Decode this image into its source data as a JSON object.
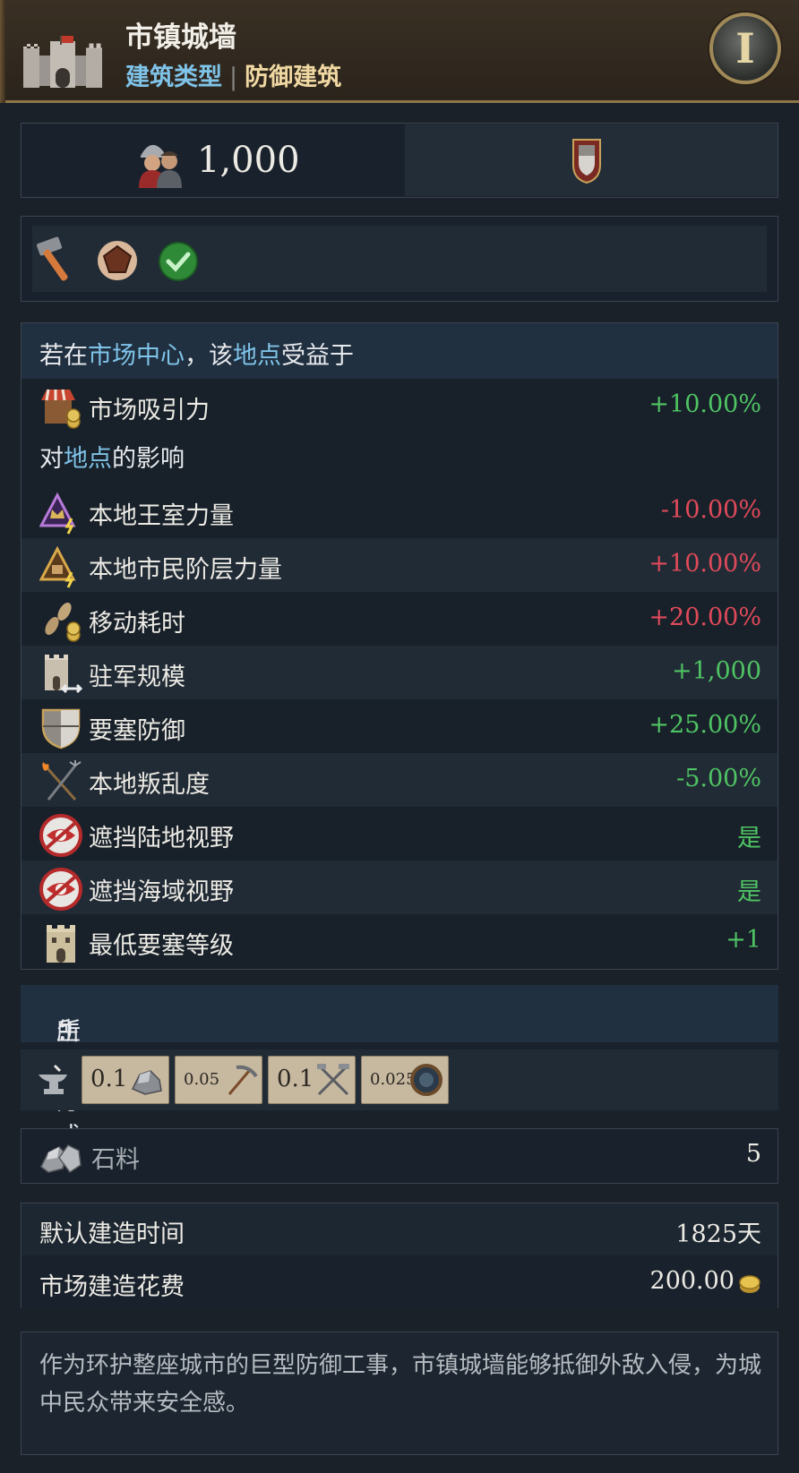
{
  "header": {
    "title": "市镇城墙",
    "type_key": "建筑类型",
    "type_sep": "|",
    "type_value": "防御建筑",
    "info_label": "I"
  },
  "stats": {
    "men_value": "1,000",
    "men_icon": "soldiers-icon",
    "badge_icon": "shield-badge-icon"
  },
  "tags": [
    "hammer-icon",
    "pentagon-icon",
    "check-icon"
  ],
  "effects": {
    "condition": {
      "prefix": "若在",
      "h1": "市场中心",
      "mid": "，该",
      "h2": "地点",
      "suffix": "受益于"
    },
    "market_row": {
      "label": "市场吸引力",
      "value": "+10.00%",
      "icon": "market-stall-icon"
    },
    "location_head": {
      "prefix": "对",
      "h": "地点",
      "suffix": "的影响"
    },
    "rows": [
      {
        "label": "本地王室力量",
        "value": "-10.00%",
        "tone": "neg",
        "icon": "crown-power-icon"
      },
      {
        "label": "本地市民阶层力量",
        "value": "+10.00%",
        "tone": "neg",
        "icon": "burgher-power-icon"
      },
      {
        "label": "移动耗时",
        "value": "+20.00%",
        "tone": "neg",
        "icon": "footsteps-icon"
      },
      {
        "label": "驻军规模",
        "value": "+1,000",
        "tone": "pos",
        "icon": "garrison-tower-icon"
      },
      {
        "label": "要塞防御",
        "value": "+25.00%",
        "tone": "pos",
        "icon": "fort-shield-icon"
      },
      {
        "label": "本地叛乱度",
        "value": "-5.00%",
        "tone": "pos",
        "icon": "torch-pitchfork-icon"
      },
      {
        "label": "遮挡陆地视野",
        "value": "是",
        "tone": "pos",
        "icon": "blocked-eye-icon"
      },
      {
        "label": "遮挡海域视野",
        "value": "是",
        "tone": "pos",
        "icon": "blocked-eye-icon"
      },
      {
        "label": "最低要塞等级",
        "value": "+1",
        "tone": "pos",
        "icon": "fort-tower-icon"
      }
    ]
  },
  "production": {
    "head_prefix": "所需",
    "head_h": "生产方式",
    "head_suffix": "：",
    "method_icon": "anvil-icon",
    "inputs": [
      {
        "amount": "0.1",
        "icon": "stone-icon"
      },
      {
        "amount": "0.05",
        "icon": "pickaxe-hammer-icon"
      },
      {
        "amount": "0.1",
        "icon": "crossed-tools-icon"
      },
      {
        "amount": "0.025",
        "icon": "bowl-icon"
      }
    ]
  },
  "stone": {
    "label": "石料",
    "value": "5",
    "icon": "stone-icon"
  },
  "costs": {
    "build_time_label": "默认建造时间",
    "build_time_value": "1825天",
    "market_cost_label": "市场建造花费",
    "market_cost_value": "200.00",
    "coin_icon": "gold-coin-icon"
  },
  "description": "作为环护整座城市的巨型防御工事，市镇城墙能够抵御外敌入侵，为城中民众带来安全感。",
  "colors": {
    "positive": "#4fc463",
    "negative": "#e04a5a",
    "highlight": "#7fc3e8",
    "gold_border": "#8d7547"
  }
}
